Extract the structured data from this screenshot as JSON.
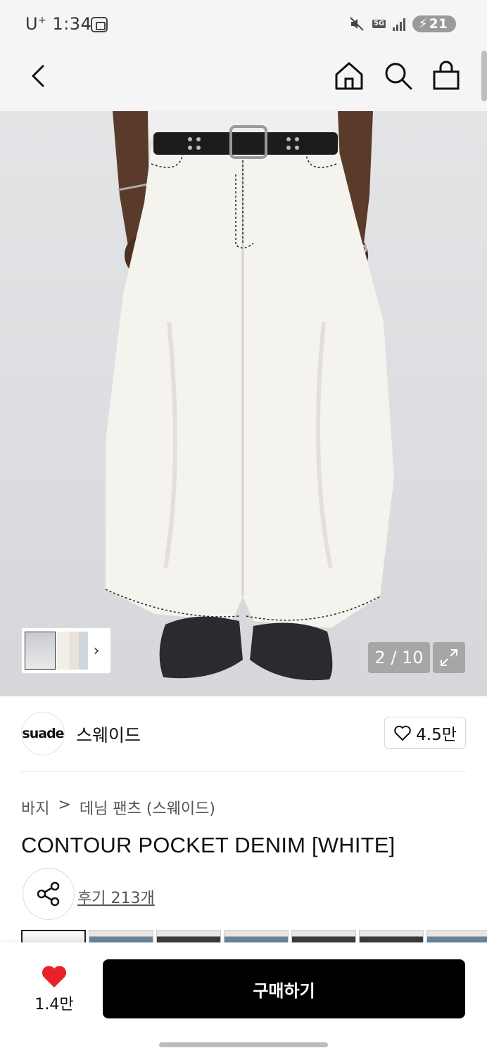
{
  "status_bar": {
    "carrier": "U",
    "carrier_sup": "+",
    "time": "1:34",
    "network": "5G",
    "battery": "21"
  },
  "header": {
    "icons": [
      "back-icon",
      "home-icon",
      "search-icon",
      "shopping-bag-icon"
    ]
  },
  "gallery": {
    "counter": "2 / 10",
    "thumbnail_more": "›"
  },
  "brand": {
    "logo_text": "suade",
    "name": "스웨이드",
    "likes": "4.5만"
  },
  "product": {
    "breadcrumb": [
      "바지",
      ">",
      "데님 팬츠 (스웨이드)"
    ],
    "title": "CONTOUR POCKET DENIM [WHITE]",
    "reviews": "후기 213개"
  },
  "bottom_bar": {
    "wish_count": "1.4만",
    "buy_label": "구매하기"
  },
  "colors": {
    "accent_red": "#e8222a",
    "buy_button": "#000000"
  }
}
